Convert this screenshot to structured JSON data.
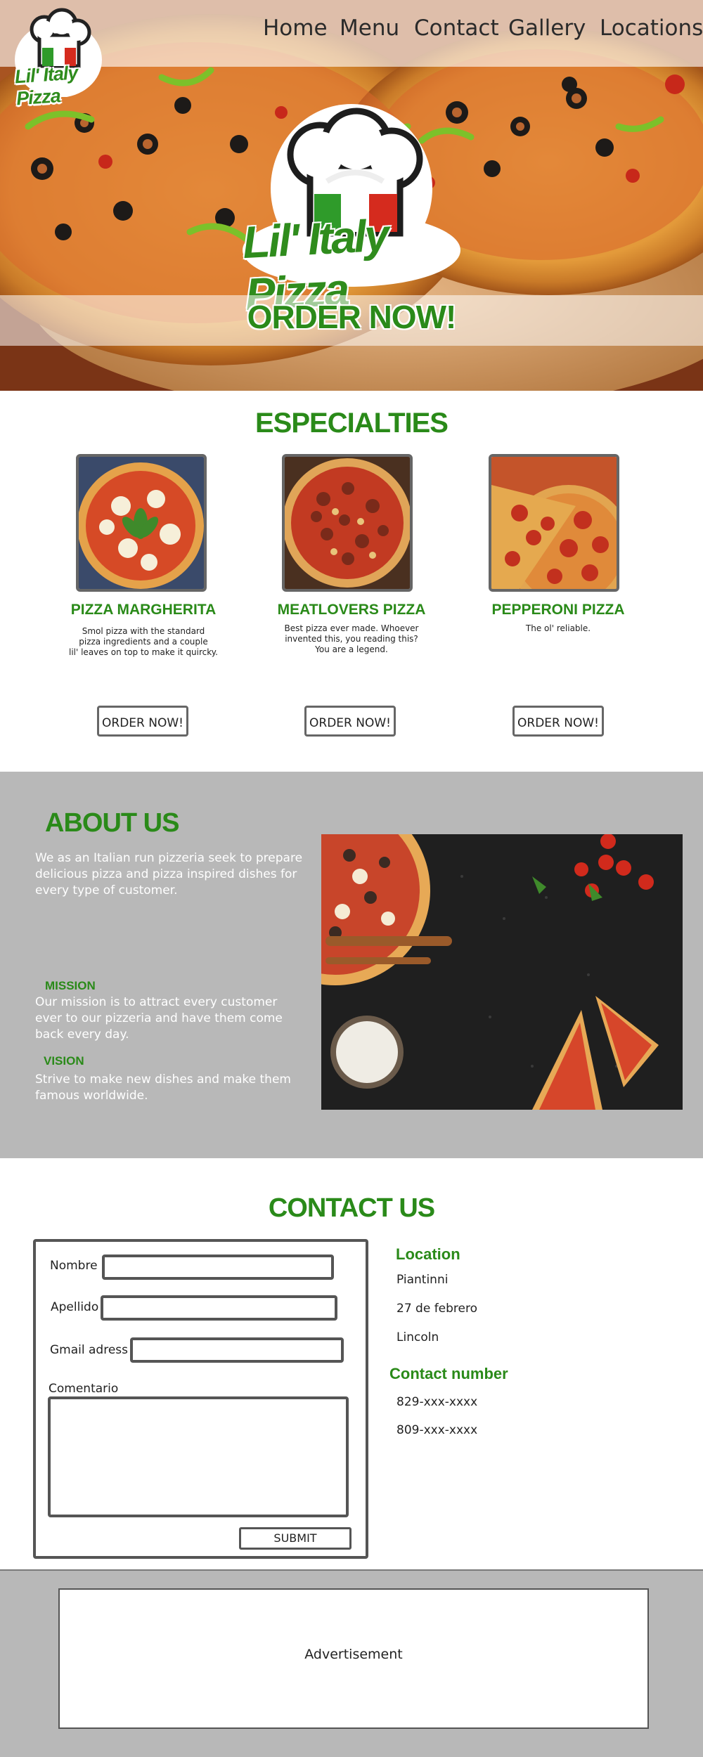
{
  "brand": {
    "name": "Lil' Italy Pizza",
    "colors": {
      "accent_green": "#2a8a19",
      "flag_red": "#d52b1e",
      "panel_gray": "#b8b8b8",
      "border_gray": "#555555"
    }
  },
  "nav": {
    "items": [
      {
        "label": "Home"
      },
      {
        "label": "Menu"
      },
      {
        "label": "Contact"
      },
      {
        "label": "Gallery"
      },
      {
        "label": "Locations"
      }
    ]
  },
  "hero": {
    "cta": "ORDER NOW!",
    "background_icon": "pizza-photo",
    "logo_icon": "chef-hat-icon"
  },
  "specialties": {
    "title": "ESPECIALTIES",
    "items": [
      {
        "name": "PIZZA MARGHERITA",
        "lines": [
          "Smol pizza with the standard",
          "pizza ingredients and a couple",
          "lil' leaves on top to make it quircky."
        ],
        "button": "ORDER NOW!"
      },
      {
        "name": "MEATLOVERS PIZZA",
        "lines": [
          "Best pizza ever made. Whoever",
          "invented this, you reading this?",
          "You are a legend."
        ],
        "button": "ORDER NOW!"
      },
      {
        "name": "PEPPERONI PIZZA",
        "lines": [
          "The ol' reliable."
        ],
        "button": "ORDER NOW!"
      }
    ]
  },
  "about": {
    "title": "ABOUT US",
    "intro": [
      "We as an Italian run pizzeria seek to prepare",
      "delicious pizza and pizza inspired dishes for",
      "every type of customer."
    ],
    "mission_title": "MISSION",
    "mission": [
      "Our mission is to attract every customer",
      "ever to our pizzeria and have them come",
      "back every day."
    ],
    "vision_title": "VISION",
    "vision": [
      "Strive to make new dishes and make them",
      "famous worldwide."
    ]
  },
  "contact": {
    "title": "CONTACT US",
    "form": {
      "name_label": "Nombre",
      "surname_label": "Apellido",
      "email_label": "Gmail adress",
      "comment_label": "Comentario",
      "submit": "SUBMIT"
    },
    "location_title": "Location",
    "locations": [
      "Piantinni",
      "27 de febrero",
      "Lincoln"
    ],
    "phone_title": "Contact number",
    "phones": [
      "829-xxx-xxxx",
      "809-xxx-xxxx"
    ]
  },
  "footer": {
    "ad_label": "Advertisement"
  }
}
